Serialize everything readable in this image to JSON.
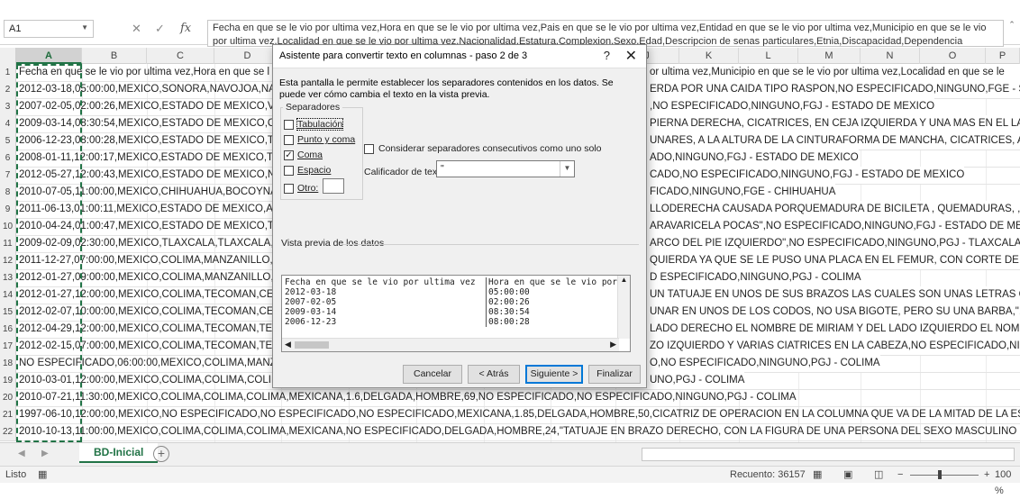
{
  "formula_bar": {
    "cell_ref": "A1",
    "fx": "fx",
    "cancel": "✕",
    "enter": "✓",
    "content": "Fecha en que se le vio por ultima vez,Hora en que se le vio por ultima vez,Pais en que se le vio por ultima vez,Entidad en que se le vio por ultima vez,Municipio en que se le vio por ultima vez,Localidad en que se le vio por ultima vez,Nacionalidad,Estatura,Complexion,Sexo,Edad,Descripcion de senas particulares,Etnia,Discapacidad,Dependencia"
  },
  "columns": [
    "A",
    "B",
    "C",
    "D",
    "E",
    "F",
    "G",
    "H",
    "I",
    "J",
    "K",
    "L",
    "M",
    "N",
    "O",
    "P"
  ],
  "rows": [
    {
      "n": "1",
      "left": "Fecha en que se le vio por ultima vez,Hora en que se l",
      "right": "or ultima vez,Municipio en que se le vio por ultima vez,Localidad en que se le"
    },
    {
      "n": "2",
      "left": "2012-03-18,05:00:00,MEXICO,SONORA,NAVOJOA,NAV",
      "right": "ERDA POR UNA CAIDA TIPO RASPON,NO ESPECIFICADO,NINGUNO,FGE - SONO"
    },
    {
      "n": "3",
      "left": "2007-02-05,02:00:26,MEXICO,ESTADO DE MEXICO,VALL",
      "right": ",NO ESPECIFICADO,NINGUNO,FGJ - ESTADO DE MEXICO"
    },
    {
      "n": "4",
      "left": "2009-03-14,08:30:54,MEXICO,ESTADO DE MEXICO,CHAI",
      "right": "PIERNA DERECHA, CICATRICES, EN CEJA IZQUIERDA Y UNA MAS EN EL LADO IZC"
    },
    {
      "n": "5",
      "left": "2006-12-23,08:00:28,MEXICO,ESTADO DE MEXICO,TLAL",
      "right": "UNARES, A LA ALTURA DE LA CINTURAFORMA DE MANCHA, CICATRICES, A UN L"
    },
    {
      "n": "6",
      "left": "2008-01-11,12:00:17,MEXICO,ESTADO DE MEXICO,TOLU",
      "right": "ADO,NINGUNO,FGJ - ESTADO DE MEXICO"
    },
    {
      "n": "7",
      "left": "2012-05-27,12:00:43,MEXICO,ESTADO DE MEXICO,NICO",
      "right": "CADO,NO ESPECIFICADO,NINGUNO,FGJ - ESTADO DE MEXICO"
    },
    {
      "n": "8",
      "left": "2010-07-05,11:00:00,MEXICO,CHIHUAHUA,BOCOYNA,C",
      "right": "FICADO,NINGUNO,FGE - CHIHUAHUA"
    },
    {
      "n": "9",
      "left": "2011-06-13,01:00:11,MEXICO,ESTADO DE MEXICO,AME",
      "right": "LLODERECHA CAUSADA PORQUEMADURA DE BICILETA , QUEMADURAS, , CICATI"
    },
    {
      "n": "10",
      "left": "2010-04-24,01:00:47,MEXICO,ESTADO DE MEXICO,TEOL",
      "right": "ARAVARICELA POCAS\",NO ESPECIFICADO,NINGUNO,FGJ - ESTADO DE MEXICO"
    },
    {
      "n": "11",
      "left": "2009-02-09,02:30:00,MEXICO,TLAXCALA,TLAXCALA,TLA",
      "right": "ARCO DEL PIE IZQUIERDO\",NO ESPECIFICADO,NINGUNO,PGJ - TLAXCALA"
    },
    {
      "n": "12",
      "left": "2011-12-27,07:00:00,MEXICO,COLIMA,MANZANILLO,DE",
      "right": "QUIERDA YA QUE SE LE PUSO UNA PLACA EN EL FEMUR, CON CORTE DE VOLCAN"
    },
    {
      "n": "13",
      "left": "2012-01-27,09:00:00,MEXICO,COLIMA,MANZANILLO,EL",
      "right": "D ESPECIFICADO,NINGUNO,PGJ - COLIMA"
    },
    {
      "n": "14",
      "left": "2012-01-27,12:00:00,MEXICO,COLIMA,TECOMAN,CERR",
      "right": "UN TATUAJE EN UNOS DE SUS BRAZOS LAS CUALES SON UNAS LETRAS QUE DIC"
    },
    {
      "n": "15",
      "left": "2012-02-07,10:00:00,MEXICO,COLIMA,TECOMAN,CERR",
      "right": "UNAR EN UNOS DE LOS CODOS, NO USA BIGOTE, PERO SU UNA BARBA,\",NO ES"
    },
    {
      "n": "16",
      "left": "2012-04-29,12:00:00,MEXICO,COLIMA,TECOMAN,TECO",
      "right": "LADO DERECHO EL NOMBRE DE MIRIAM Y DEL LADO IZQUIERDO EL NOMBRE DE"
    },
    {
      "n": "17",
      "left": "2012-02-15,07:00:00,MEXICO,COLIMA,TECOMAN,TECO",
      "right": "ZO IZQUIERDO Y VARIAS CIATRICES EN LA CABEZA,NO ESPECIFICADO,NINGUN"
    },
    {
      "n": "18",
      "left": "NO ESPECIFICADO,06:00:00,MEXICO,COLIMA,MANZAN",
      "right": "O,NO ESPECIFICADO,NINGUNO,PGJ - COLIMA"
    },
    {
      "n": "19",
      "left": "2010-03-01,12:00:00,MEXICO,COLIMA,COLIMA,COLIMA",
      "right": "UNO,PGJ - COLIMA"
    },
    {
      "n": "20",
      "left": "2010-07-21,11:30:00,MEXICO,COLIMA,COLIMA,COLIMA,MEXICANA,1.6,DELGADA,HOMBRE,69,NO ESPECIFICADO,NO ESPECIFICADO,NINGUNO,PGJ - COLIMA",
      "right": ""
    },
    {
      "n": "21",
      "left": "1997-06-10,12:00:00,MEXICO,NO ESPECIFICADO,NO ESPECIFICADO,NO ESPECIFICADO,MEXICANA,1.85,DELGADA,HOMBRE,50,CICATRIZ DE OPERACION EN LA COLUMNA QUE VA DE LA MITAD DE LA ESPALDA A LA NUCA",
      "right": ""
    },
    {
      "n": "22",
      "left": "2010-10-13,11:00:00,MEXICO,COLIMA,COLIMA,COLIMA,MEXICANA,NO ESPECIFICADO,DELGADA,HOMBRE,24,\"TATUAJE EN BRAZO DERECHO, CON LA FIGURA DE UNA PERSONA DEL SEXO MASCULINO DE EMILIANO ZAP",
      "right": ""
    }
  ],
  "sheet_tab": "BD-Inicial",
  "status": {
    "ready": "Listo",
    "count": "Recuento: 36157",
    "zoom": "100 %"
  },
  "dialog": {
    "title": "Asistente para convertir texto en columnas - paso 2 de 3",
    "help": "?",
    "close": "✕",
    "info": "Esta pantalla le permite establecer los separadores contenidos en los datos. Se puede ver cómo cambia el texto en la vista previa.",
    "separators_label": "Separadores",
    "separators": [
      {
        "label": "Tabulación",
        "checked": false
      },
      {
        "label": "Punto y coma",
        "checked": false
      },
      {
        "label": "Coma",
        "checked": true
      },
      {
        "label": "Espacio",
        "checked": false
      },
      {
        "label": "Otro:",
        "checked": false
      }
    ],
    "consecutive_label": "Considerar separadores consecutivos como uno solo",
    "qualifier_label": "Calificador de texto:",
    "qualifier_value": "\"",
    "preview_label": "Vista previa de los datos",
    "preview_col1": [
      "Fecha en que se le vio por ultima vez",
      "2012-03-18",
      "2007-02-05",
      "2009-03-14",
      "2006-12-23"
    ],
    "preview_col2": [
      "Hora en que se le vio por u",
      "05:00:00",
      "02:00:26",
      "08:30:54",
      "08:00:28"
    ],
    "buttons": {
      "cancel": "Cancelar",
      "back": "< Atrás",
      "next": "Siguiente >",
      "finish": "Finalizar"
    }
  }
}
